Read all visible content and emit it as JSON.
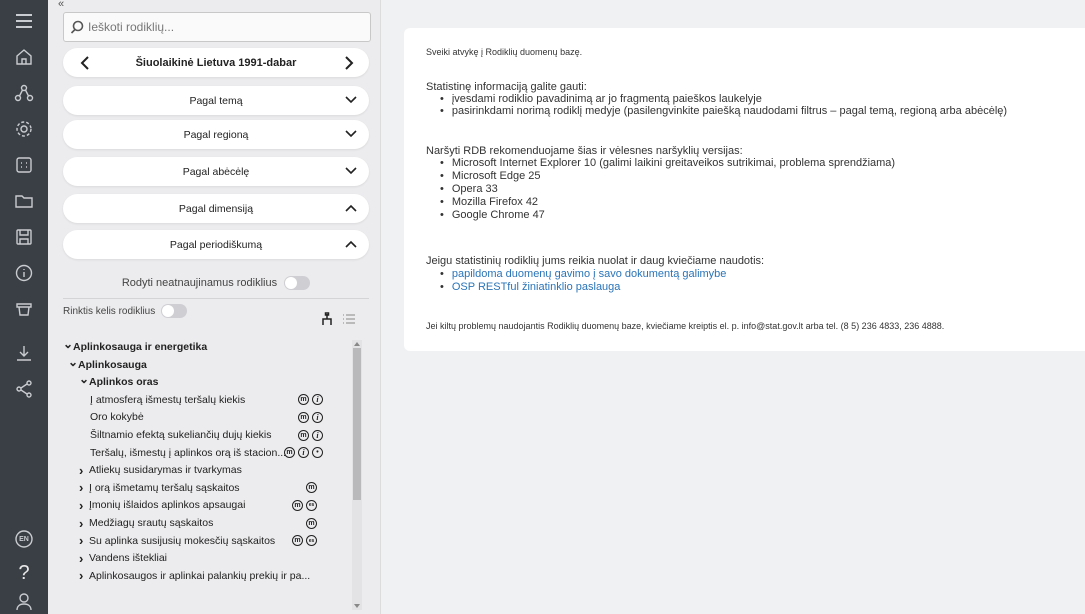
{
  "rail": {
    "items": [
      "menu",
      "home",
      "network",
      "settings",
      "table",
      "folder",
      "save",
      "info",
      "basket",
      "download",
      "share"
    ],
    "lang": "EN",
    "help": "?",
    "user": "user"
  },
  "search": {
    "placeholder": "Ieškoti rodiklių..."
  },
  "period_nav": {
    "label": "Šiuolaikinė Lietuva 1991-dabar"
  },
  "filters": [
    {
      "label": "Pagal temą",
      "state": "collapsed"
    },
    {
      "label": "Pagal regioną",
      "state": "collapsed"
    },
    {
      "label": "Pagal abėcėlę",
      "state": "collapsed"
    },
    {
      "label": "Pagal dimensiją",
      "state": "expanded"
    },
    {
      "label": "Pagal periodiškumą",
      "state": "expanded"
    }
  ],
  "options": {
    "show_stale_label": "Rodyti neatnaujinamus rodiklius",
    "multi_select_label": "Rinktis kelis rodiklius"
  },
  "tree": [
    {
      "label": "Aplinkosauga ir energetika",
      "level": 0,
      "bold": true,
      "caret": "down",
      "icons": []
    },
    {
      "label": "Aplinkosauga",
      "level": 1,
      "bold": true,
      "caret": "down",
      "icons": []
    },
    {
      "label": "Aplinkos oras",
      "level": 2,
      "bold": true,
      "caret": "down",
      "icons": []
    },
    {
      "label": "Į atmosferą išmestų teršalų kiekis",
      "level": 3,
      "bold": false,
      "caret": "",
      "icons": [
        "m",
        "i"
      ]
    },
    {
      "label": "Oro kokybė",
      "level": 3,
      "bold": false,
      "caret": "",
      "icons": [
        "m",
        "i"
      ]
    },
    {
      "label": "Šiltnamio efektą sukeliančių dujų kiekis",
      "level": 3,
      "bold": false,
      "caret": "",
      "icons": [
        "m",
        "i"
      ]
    },
    {
      "label": "Teršalų, išmestų į aplinkos orą iš stacion...",
      "level": 3,
      "bold": false,
      "caret": "",
      "icons": [
        "m",
        "i",
        "pin"
      ]
    },
    {
      "label": "Atliekų susidarymas ir tvarkymas",
      "level": 2,
      "bold": false,
      "caret": "right",
      "icons": []
    },
    {
      "label": "Į orą išmetamų teršalų sąskaitos",
      "level": 2,
      "bold": false,
      "caret": "right",
      "icons": [
        "m"
      ]
    },
    {
      "label": "Įmonių išlaidos aplinkos apsaugai",
      "level": 2,
      "bold": false,
      "caret": "right",
      "icons": [
        "m",
        "es"
      ]
    },
    {
      "label": "Medžiagų srautų sąskaitos",
      "level": 2,
      "bold": false,
      "caret": "right",
      "icons": [
        "m"
      ]
    },
    {
      "label": "Su aplinka susijusių mokesčių sąskaitos",
      "level": 2,
      "bold": false,
      "caret": "right",
      "icons": [
        "m",
        "es"
      ]
    },
    {
      "label": "Vandens ištekliai",
      "level": 2,
      "bold": false,
      "caret": "right",
      "icons": []
    },
    {
      "label": "Aplinkosaugos ir aplinkai palankių prekių ir pa...",
      "level": 2,
      "bold": false,
      "caret": "right",
      "icons": []
    }
  ],
  "welcome": {
    "greeting": "Sveiki atvykę į Rodiklių duomenų bazę.",
    "stats_intro": "Statistinę informaciją galite gauti:",
    "stats_items": [
      "įvesdami rodiklio pavadinimą ar jo fragmentą paieškos laukelyje",
      "pasirinkdami norimą rodiklį medyje (pasilengvinkite paiešką naudodami filtrus – pagal temą, regioną arba abėcėlę)"
    ],
    "browsers_intro": "Naršyti RDB rekomenduojame šias ir vėlesnes naršyklių versijas:",
    "browsers": [
      "Microsoft Internet Explorer 10 (galimi laikini greitaveikos sutrikimai, problema sprendžiama)",
      "Microsoft Edge 25",
      "Opera 33",
      "Mozilla Firefox 42",
      "Google Chrome 47"
    ],
    "links_intro": "Jeigu statistinių rodiklių jums reikia nuolat ir daug kviečiame naudotis:",
    "links": [
      "papildoma duomenų gavimo į savo dokumentą galimybe",
      "OSP RESTful žiniatinklio paslauga"
    ],
    "contact": "Jei kiltų problemų naudojantis Rodiklių duomenų baze, kviečiame kreiptis el. p. info@stat.gov.lt arba tel. (8 5) 236 4833, 236 4888."
  },
  "colors": {
    "rail": "#3a3f45",
    "link": "#2a74b8",
    "panel": "#ececee"
  }
}
